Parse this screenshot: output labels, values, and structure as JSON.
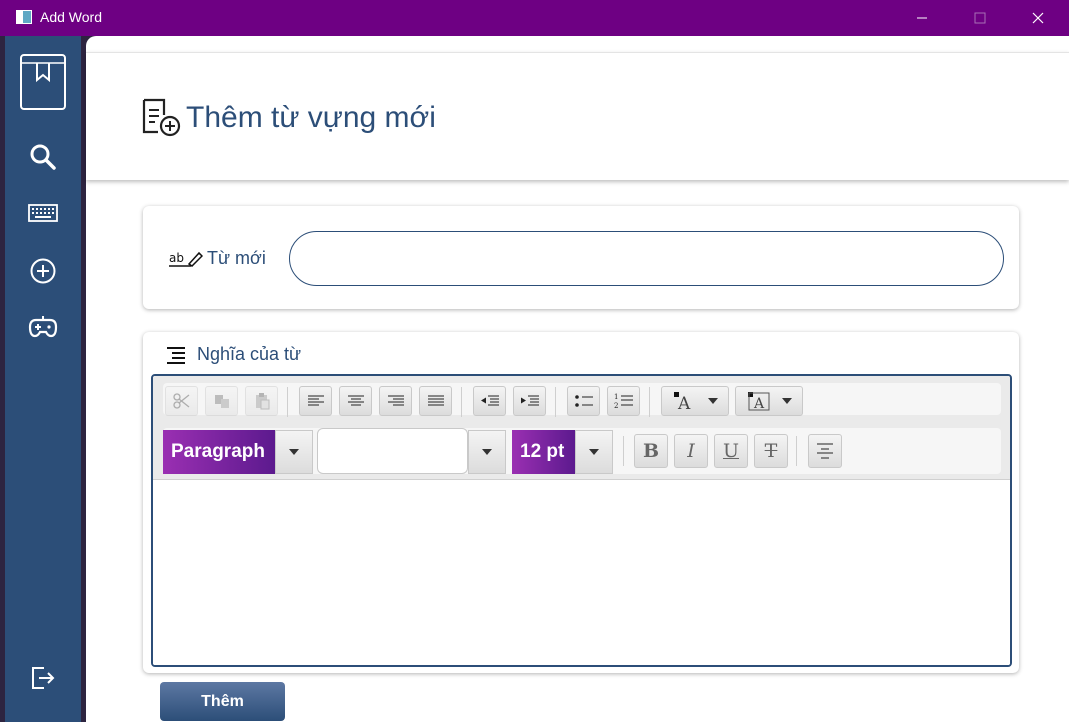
{
  "window": {
    "title": "Add Word",
    "controls": {
      "minimize": "—",
      "maximize": "☐",
      "close": "✕"
    }
  },
  "sidebar": {
    "items": [
      {
        "icon": "dictionary-book-icon"
      },
      {
        "icon": "search-icon"
      },
      {
        "icon": "keyboard-icon"
      },
      {
        "icon": "add-circle-icon"
      },
      {
        "icon": "gamepad-icon"
      }
    ],
    "logout_icon": "logout-icon",
    "color": "#2c4e78"
  },
  "header": {
    "title": "Thêm từ vựng mới",
    "icon": "add-document-icon"
  },
  "word_field": {
    "label": "Từ mới",
    "icon": "spell-check-icon",
    "value": ""
  },
  "meaning_field": {
    "label": "Nghĩa của từ",
    "icon": "menu-lines-icon"
  },
  "editor": {
    "toolbar_row1": [
      "cut",
      "copy",
      "paste",
      "align-left",
      "align-center",
      "align-right",
      "align-justify",
      "outdent",
      "indent",
      "bullet-list",
      "numbered-list",
      "font-color",
      "highlight-color"
    ],
    "paragraph_style": "Paragraph",
    "font_family": "",
    "font_size": "12 pt",
    "bold": "B",
    "italic": "I",
    "underline": "U",
    "strikethrough": "T",
    "content": ""
  },
  "submit_label": "Thêm",
  "colors": {
    "titlebar": "#6e0083",
    "accent": "#2c4e78",
    "combo": "#7b24a0"
  }
}
